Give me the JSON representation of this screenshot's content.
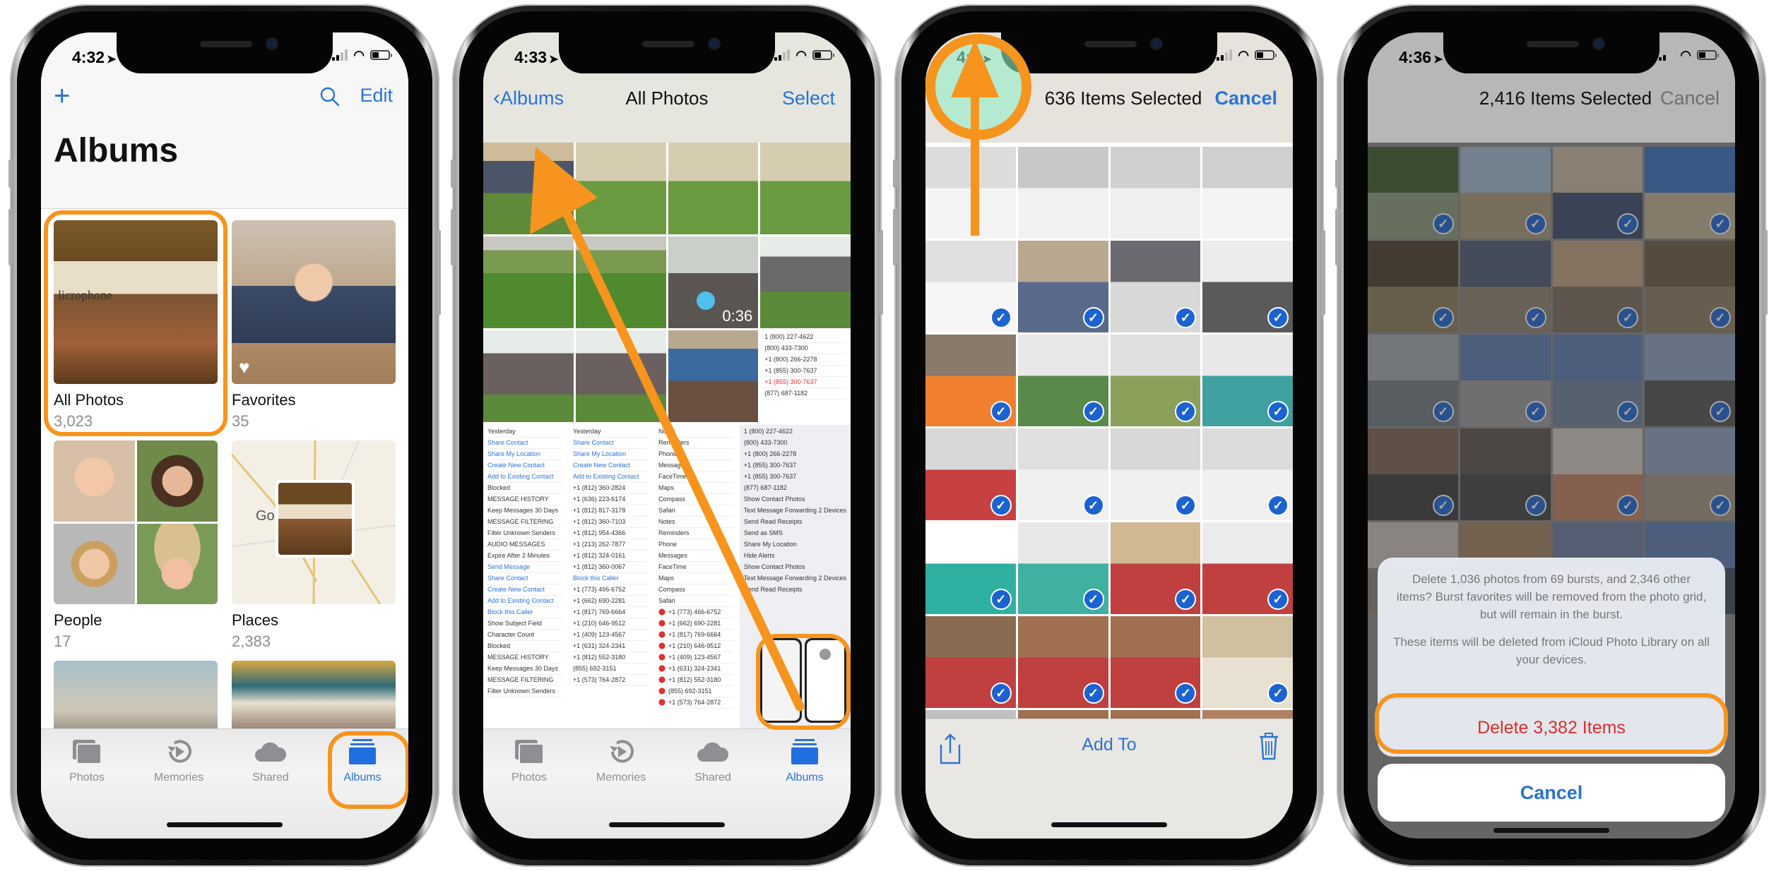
{
  "accent": "#2a73d6",
  "highlight_color": "#f7941d",
  "destructive_color": "#d9302c",
  "status_icons": [
    "signal-icon",
    "wifi-icon",
    "battery-icon",
    "location-arrow-icon"
  ],
  "phone1": {
    "time": "4:32",
    "add_icon": "+",
    "search_icon": "search-icon",
    "edit_label": "Edit",
    "title": "Albums",
    "albums": [
      {
        "name": "All Photos",
        "count": "3,023"
      },
      {
        "name": "Favorites",
        "count": "35"
      },
      {
        "name": "People",
        "count": "17"
      },
      {
        "name": "Places",
        "count": "2,383"
      }
    ],
    "places_map_label": "Go",
    "tabs": [
      {
        "label": "Photos",
        "icon": "photos-icon"
      },
      {
        "label": "Memories",
        "icon": "memories-icon"
      },
      {
        "label": "Shared",
        "icon": "cloud-icon"
      },
      {
        "label": "Albums",
        "icon": "albums-icon",
        "active": true
      }
    ]
  },
  "phone2": {
    "time": "4:33",
    "back_label": "Albums",
    "title": "All Photos",
    "select_label": "Select",
    "video_duration": "0:36",
    "screenshot_lists": {
      "col1": [
        "Yesterday",
        "Share Contact",
        "Share My Location",
        "Create New Contact",
        "Add to Existing Contact",
        "Blocked",
        "MESSAGE HISTORY",
        "Keep Messages   30 Days",
        "MESSAGE FILTERING",
        "Filter Unknown Senders",
        "AUDIO MESSAGES",
        "Expire   After 2 Minutes",
        "Send Message",
        "Share Contact",
        "Create New Contact",
        "Add to Existing Contact",
        "Block this Caller",
        "Show Subject Field",
        "Character Count",
        "Blocked",
        "MESSAGE HISTORY",
        "Keep Messages   30 Days",
        "MESSAGE FILTERING",
        "Filter Unknown Senders"
      ],
      "col2": [
        "Yesterday",
        "Share Contact",
        "Share My Location",
        "Create New Contact",
        "Add to Existing Contact",
        "+1 (812) 360-2824",
        "+1 (636) 223-6174",
        "+1 (812) 817-3178",
        "+1 (812) 360-7103",
        "+1 (812) 954-4366",
        "+1 (213) 262-7877",
        "+1 (812) 324-0161",
        "+1 (812) 360-0067",
        "Block this Caller",
        "+1 (773) 466-6752",
        "+1 (662) 690-2281",
        "+1 (817) 769-6664",
        "+1 (210) 646-9512",
        "+1 (409) 123-4567",
        "+1 (631) 324-2341",
        "+1 (812) 552-3180",
        "(855) 692-3151",
        "+1 (573) 764-2872"
      ],
      "col3": [
        "Notes",
        "Reminders",
        "Phone",
        "Messages",
        "FaceTime",
        "Maps",
        "Compass",
        "Safari",
        "Notes",
        "Reminders",
        "Phone",
        "Messages",
        "FaceTime",
        "Maps",
        "Compass",
        "Safari",
        "+1 (773) 466-6752",
        "+1 (662) 690-2281",
        "+1 (817) 769-6664",
        "+1 (210) 646-9512",
        "+1 (409) 123-4567",
        "+1 (631) 324-2341",
        "+1 (812) 552-3180",
        "(855) 692-3151",
        "+1 (573) 764-2872"
      ],
      "col4": [
        "1 (800) 227-4622",
        "(800) 433-7300",
        "+1 (800) 266-2278",
        "+1 (855) 300-7637",
        "+1 (855) 300-7637",
        "(877) 687-1182",
        "Show Contact Photos",
        "Text Message Forwarding   2 Devices",
        "Send Read Receipts",
        "Send as SMS",
        "Share My Location",
        "Hide Alerts",
        "Show Contact Photos",
        "Text Message Forwarding   2 Devices",
        "Send Read Receipts"
      ]
    },
    "tabs": [
      {
        "label": "Photos",
        "icon": "photos-icon"
      },
      {
        "label": "Memories",
        "icon": "memories-icon"
      },
      {
        "label": "Shared",
        "icon": "cloud-icon"
      },
      {
        "label": "Albums",
        "icon": "albums-icon",
        "active": true
      }
    ]
  },
  "phone3": {
    "time": "4:3",
    "title": "636 Items Selected",
    "cancel_label": "Cancel",
    "add_to_label": "Add To",
    "share_icon": "share-icon",
    "trash_icon": "trash-icon",
    "selected_rows": 7
  },
  "phone4": {
    "time": "4:36",
    "title": "2,416 Items Selected",
    "cancel_label": "Cancel",
    "alert_message_1": "Delete 1,036 photos from 69 bursts, and 2,346 other items? Burst favorites will be removed from the photo grid, but will remain in the burst.",
    "alert_message_2": "These items will be deleted from iCloud Photo Library on all your devices.",
    "delete_label": "Delete 3,382 Items",
    "sheet_cancel_label": "Cancel"
  }
}
